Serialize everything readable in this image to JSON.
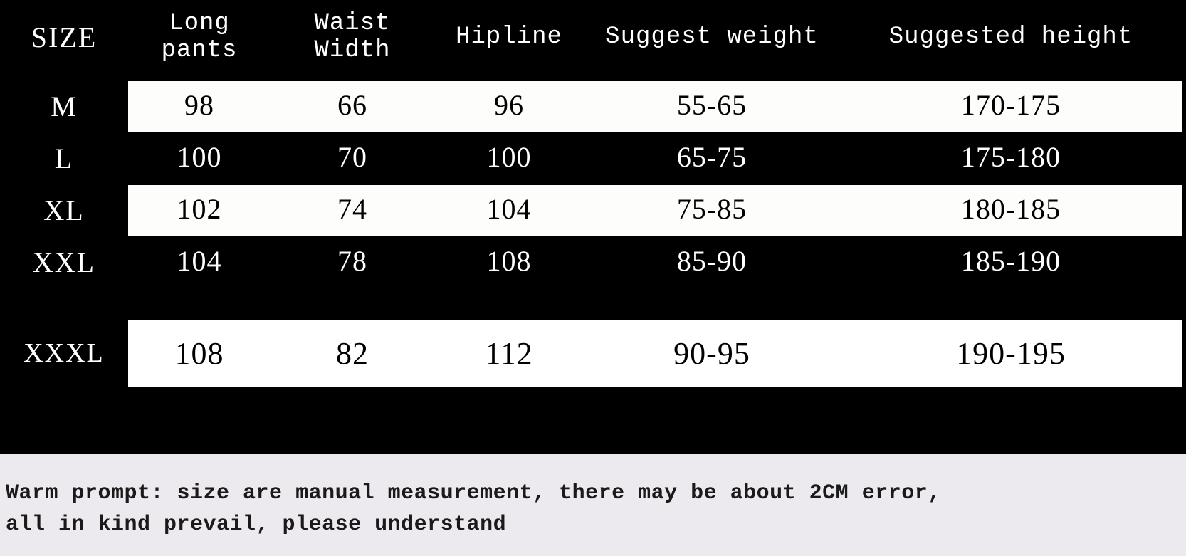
{
  "headers": {
    "size": "SIZE",
    "long_pants": "Long pants",
    "waist_width": "Waist Width",
    "hipline": "Hipline",
    "suggest_weight": "Suggest weight",
    "suggested_height": "Suggested height"
  },
  "rows": [
    {
      "size": "M",
      "long_pants": "98",
      "waist_width": "66",
      "hipline": "96",
      "suggest_weight": "55-65",
      "suggested_height": "170-175"
    },
    {
      "size": "L",
      "long_pants": "100",
      "waist_width": "70",
      "hipline": "100",
      "suggest_weight": "65-75",
      "suggested_height": "175-180"
    },
    {
      "size": "XL",
      "long_pants": "102",
      "waist_width": "74",
      "hipline": "104",
      "suggest_weight": "75-85",
      "suggested_height": "180-185"
    },
    {
      "size": "XXL",
      "long_pants": "104",
      "waist_width": "78",
      "hipline": "108",
      "suggest_weight": "85-90",
      "suggested_height": "185-190"
    },
    {
      "size": "XXXL",
      "long_pants": "108",
      "waist_width": "82",
      "hipline": "112",
      "suggest_weight": "90-95",
      "suggested_height": "190-195"
    }
  ],
  "footer": {
    "line1": "Warm prompt: size are manual measurement, there may be about 2CM error,",
    "line2": "all in kind prevail, please understand"
  }
}
